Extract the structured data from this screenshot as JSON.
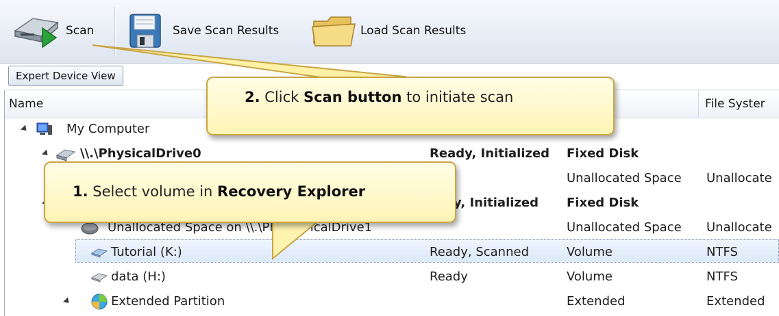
{
  "toolbar": {
    "scan_label": "Scan",
    "save_label": "Save Scan Results",
    "load_label": "Load Scan Results"
  },
  "expert_view_label": "Expert Device View",
  "columns": {
    "name": "Name",
    "file_system": "File Syster"
  },
  "rows": [
    {
      "name": "My Computer",
      "status": "",
      "type": "",
      "fs": ""
    },
    {
      "name": "\\\\.\\PhysicalDrive0",
      "status": "Ready, Initialized",
      "type": "Fixed Disk",
      "fs": ""
    },
    {
      "name": "",
      "status": "",
      "type": "Unallocated Space",
      "fs": "Unallocate"
    },
    {
      "name": "",
      "status": "ady, Initialized",
      "type": "Fixed Disk",
      "fs": ""
    },
    {
      "name": "Unallocated Space on \\\\.\\Ph",
      "name_tail": "ıcalDrive1",
      "status": "",
      "type": "Unallocated Space",
      "fs": "Unallocate"
    },
    {
      "name": "Tutorial (K:)",
      "status": "Ready, Scanned",
      "type": "Volume",
      "fs": "NTFS"
    },
    {
      "name": "data (H:)",
      "status": "Ready",
      "type": "Volume",
      "fs": "NTFS"
    },
    {
      "name": "Extended Partition",
      "status": "",
      "type": "Extended",
      "fs": "Extended"
    }
  ],
  "callout_scan": {
    "step": "2.",
    "pre": " Click ",
    "strong": "Scan button",
    "post": " to initiate scan"
  },
  "callout_select": {
    "step": "1.",
    "pre": " Select volume in ",
    "strong": "Recovery Explorer"
  },
  "colors": {
    "callout_fill": "#fff6c2",
    "callout_border": "#c9a544",
    "selection": "#dce9f8",
    "scan_arrow": "#2aa13a"
  }
}
